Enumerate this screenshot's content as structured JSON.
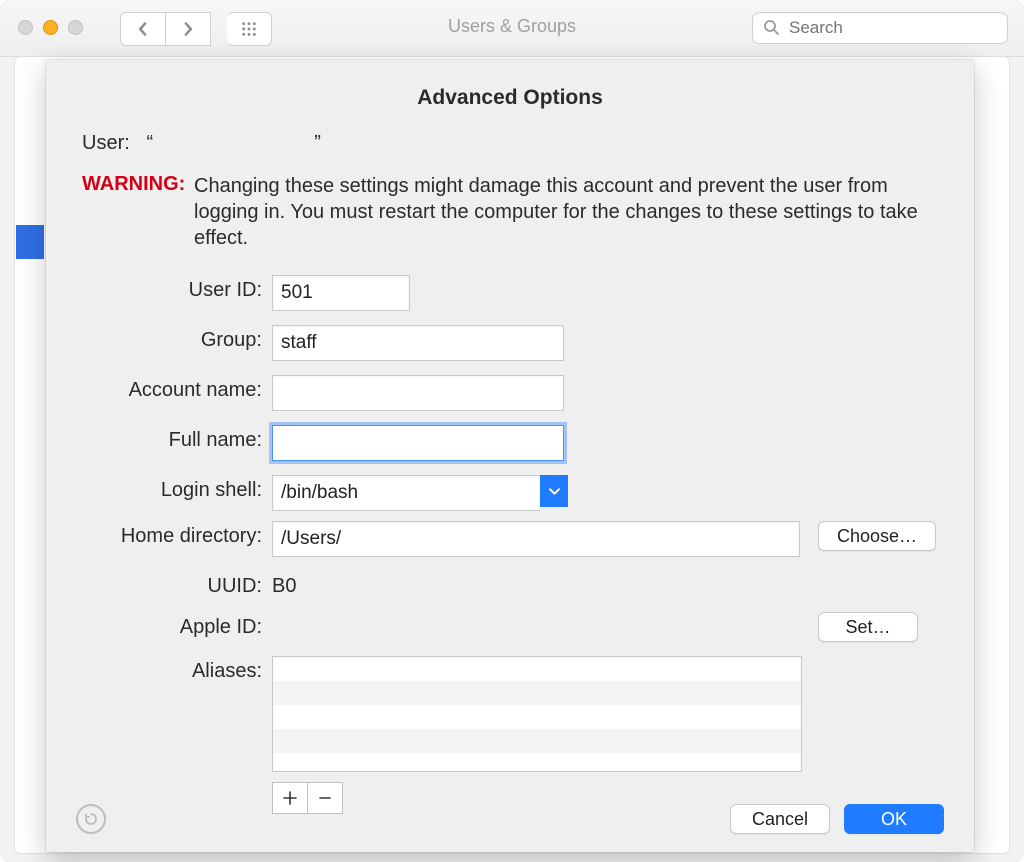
{
  "window": {
    "title": "Users & Groups",
    "search_placeholder": "Search"
  },
  "sheet": {
    "title": "Advanced Options",
    "user_label": "User:",
    "user_quote_open": "“",
    "user_name": "",
    "user_quote_close": "”",
    "warning_label": "WARNING:",
    "warning_text": "Changing these settings might damage this account and prevent the user from logging in. You must restart the computer for the changes to these settings to take effect.",
    "labels": {
      "user_id": "User ID:",
      "group": "Group:",
      "account_name": "Account name:",
      "full_name": "Full name:",
      "login_shell": "Login shell:",
      "home_directory": "Home directory:",
      "uuid": "UUID:",
      "apple_id": "Apple ID:",
      "aliases": "Aliases:"
    },
    "values": {
      "user_id": "501",
      "group": "staff",
      "account_name": "",
      "full_name": "",
      "login_shell": "/bin/bash",
      "home_directory": "/Users/",
      "uuid": "B0",
      "apple_id": ""
    },
    "buttons": {
      "choose": "Choose…",
      "set": "Set…",
      "add": "+",
      "remove": "–",
      "cancel": "Cancel",
      "ok": "OK"
    }
  }
}
